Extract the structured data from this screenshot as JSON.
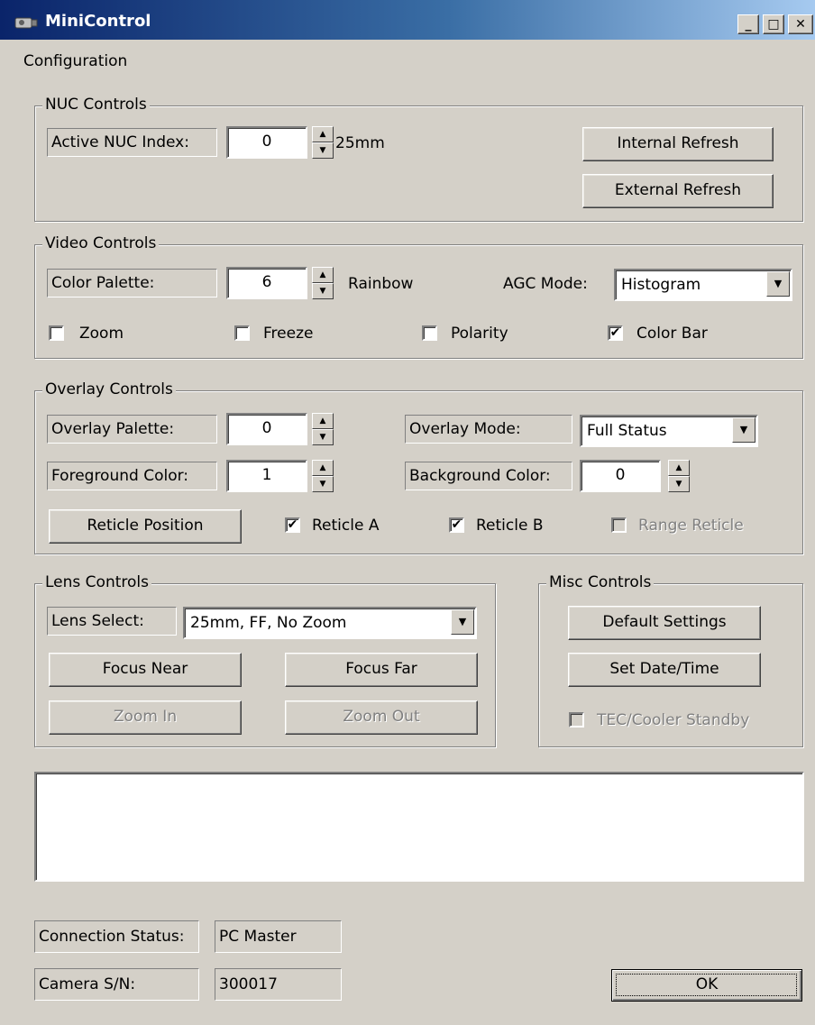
{
  "window": {
    "title": "MiniControl",
    "icon": "camera-icon",
    "controls": {
      "minimize": "_",
      "maximize": "□",
      "close": "✕"
    }
  },
  "menu": {
    "items": [
      "Configuration"
    ]
  },
  "nuc": {
    "legend": "NUC Controls",
    "index_label": "Active NUC Index:",
    "index_value": "0",
    "index_desc": "25mm",
    "internal_refresh": "Internal Refresh",
    "external_refresh": "External Refresh"
  },
  "video": {
    "legend": "Video Controls",
    "palette_label": "Color Palette:",
    "palette_value": "6",
    "palette_name": "Rainbow",
    "agc_label": "AGC Mode:",
    "agc_value": "Histogram",
    "zoom": {
      "label": "Zoom",
      "checked": false
    },
    "freeze": {
      "label": "Freeze",
      "checked": false
    },
    "polarity": {
      "label": "Polarity",
      "checked": false
    },
    "color_bar": {
      "label": "Color Bar",
      "checked": true
    }
  },
  "overlay": {
    "legend": "Overlay Controls",
    "palette_label": "Overlay Palette:",
    "palette_value": "0",
    "mode_label": "Overlay Mode:",
    "mode_value": "Full Status",
    "fg_label": "Foreground Color:",
    "fg_value": "1",
    "bg_label": "Background Color:",
    "bg_value": "0",
    "reticle_position": "Reticle Position",
    "reticle_a": {
      "label": "Reticle A",
      "checked": true
    },
    "reticle_b": {
      "label": "Reticle B",
      "checked": true
    },
    "range_reticle": {
      "label": "Range Reticle",
      "checked": false,
      "disabled": true
    }
  },
  "lens": {
    "legend": "Lens Controls",
    "select_label": "Lens Select:",
    "select_value": "25mm, FF, No Zoom",
    "focus_near": "Focus Near",
    "focus_far": "Focus Far",
    "zoom_in": "Zoom In",
    "zoom_out": "Zoom Out"
  },
  "misc": {
    "legend": "Misc Controls",
    "default_settings": "Default Settings",
    "set_datetime": "Set Date/Time",
    "tec_standby": {
      "label": "TEC/Cooler Standby",
      "checked": false,
      "disabled": true
    }
  },
  "status": {
    "connection_label": "Connection Status:",
    "connection_value": "PC Master",
    "serial_label": "Camera S/N:",
    "serial_value": "300017"
  },
  "footer": {
    "ok": "OK"
  },
  "glyphs": {
    "check": "✔",
    "spin_up": "▲",
    "spin_down": "▼",
    "dropdown": "▼"
  },
  "colors": {
    "titlebar_start": "#0a246a",
    "titlebar_end": "#a6caf0",
    "face": "#d4d0c8"
  }
}
